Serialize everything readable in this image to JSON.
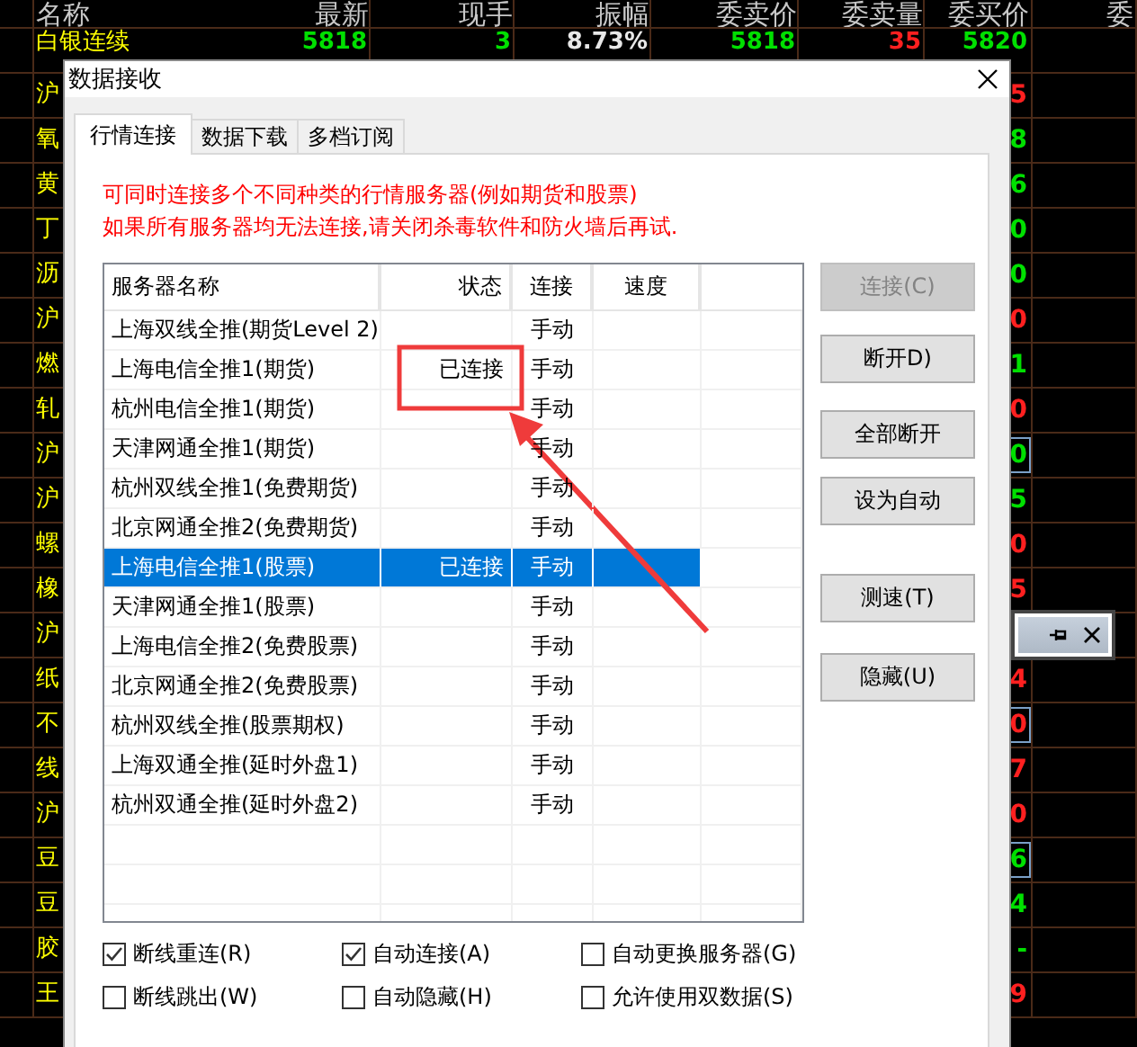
{
  "market_table": {
    "columns": [
      "名称",
      "最新",
      "现手",
      "振幅",
      "委卖价",
      "委卖量",
      "委买价",
      "委"
    ],
    "rows": [
      {
        "cells": [
          {
            "text": "白银连续"
          },
          {
            "text": "5818",
            "kind": "down"
          },
          {
            "text": "3",
            "kind": "down"
          },
          {
            "text": "8.73%",
            "kind": "flat"
          },
          {
            "text": "5818",
            "kind": "down"
          },
          {
            "text": "35",
            "kind": "up"
          },
          {
            "text": "5820",
            "kind": "down",
            "boxed": false
          }
        ]
      },
      {
        "cells": [
          {
            "text": "沪"
          },
          null,
          null,
          null,
          null,
          null,
          {
            "text": "5",
            "kind": "up",
            "boxed": false
          }
        ]
      },
      {
        "cells": [
          {
            "text": "氧"
          },
          null,
          null,
          null,
          null,
          null,
          {
            "text": "8",
            "kind": "down",
            "boxed": false
          }
        ]
      },
      {
        "cells": [
          {
            "text": "黄"
          },
          null,
          null,
          null,
          null,
          null,
          {
            "text": "6",
            "kind": "down",
            "boxed": false
          }
        ]
      },
      {
        "cells": [
          {
            "text": "丁"
          },
          null,
          null,
          null,
          null,
          null,
          {
            "text": "0",
            "kind": "down",
            "boxed": false
          }
        ]
      },
      {
        "cells": [
          {
            "text": "沥"
          },
          null,
          null,
          null,
          null,
          null,
          {
            "text": "0",
            "kind": "down",
            "boxed": false
          }
        ]
      },
      {
        "cells": [
          {
            "text": "沪"
          },
          null,
          null,
          null,
          null,
          null,
          {
            "text": "0",
            "kind": "up",
            "boxed": false
          }
        ]
      },
      {
        "cells": [
          {
            "text": "燃"
          },
          null,
          null,
          null,
          null,
          null,
          {
            "text": "1",
            "kind": "down",
            "boxed": false
          }
        ]
      },
      {
        "cells": [
          {
            "text": "轧"
          },
          null,
          null,
          null,
          null,
          null,
          {
            "text": "0",
            "kind": "up",
            "boxed": false
          }
        ]
      },
      {
        "cells": [
          {
            "text": "沪"
          },
          null,
          null,
          null,
          null,
          null,
          {
            "text": "0",
            "kind": "down",
            "boxed": true
          }
        ]
      },
      {
        "cells": [
          {
            "text": "沪"
          },
          null,
          null,
          null,
          null,
          null,
          {
            "text": "5",
            "kind": "down",
            "boxed": false
          }
        ]
      },
      {
        "cells": [
          {
            "text": "螺"
          },
          null,
          null,
          null,
          null,
          null,
          {
            "text": "0",
            "kind": "up",
            "boxed": false
          }
        ]
      },
      {
        "cells": [
          {
            "text": "橡"
          },
          null,
          null,
          null,
          null,
          null,
          {
            "text": "5",
            "kind": "up",
            "boxed": false
          }
        ]
      },
      {
        "cells": [
          {
            "text": "沪"
          },
          null,
          null,
          null,
          null,
          null,
          null
        ]
      },
      {
        "cells": [
          {
            "text": "纸"
          },
          null,
          null,
          null,
          null,
          null,
          {
            "text": "4",
            "kind": "up",
            "boxed": false
          }
        ]
      },
      {
        "cells": [
          {
            "text": "不"
          },
          null,
          null,
          null,
          null,
          null,
          {
            "text": "0",
            "kind": "up",
            "boxed": true
          }
        ]
      },
      {
        "cells": [
          {
            "text": "线"
          },
          null,
          null,
          null,
          null,
          null,
          {
            "text": "7",
            "kind": "up",
            "boxed": false
          }
        ]
      },
      {
        "cells": [
          {
            "text": "沪"
          },
          null,
          null,
          null,
          null,
          null,
          {
            "text": "0",
            "kind": "up",
            "boxed": false
          }
        ]
      },
      {
        "cells": [
          {
            "text": "豆"
          },
          null,
          null,
          null,
          null,
          null,
          {
            "text": "6",
            "kind": "down",
            "boxed": true
          }
        ]
      },
      {
        "cells": [
          {
            "text": "豆"
          },
          null,
          null,
          null,
          null,
          null,
          {
            "text": "4",
            "kind": "down",
            "boxed": false
          }
        ]
      },
      {
        "cells": [
          {
            "text": "胶"
          },
          null,
          null,
          null,
          null,
          null,
          {
            "text": "-",
            "kind": "down",
            "boxed": false
          }
        ]
      },
      {
        "cells": [
          {
            "text": "王"
          },
          null,
          null,
          null,
          null,
          null,
          {
            "text": "9",
            "kind": "up",
            "boxed": false
          }
        ]
      }
    ]
  },
  "dialog": {
    "title": "数据接收",
    "tabs": [
      {
        "label": "行情连接",
        "selected": true
      },
      {
        "label": "数据下载",
        "selected": false
      },
      {
        "label": "多档订阅",
        "selected": false
      }
    ],
    "notes": [
      "可同时连接多个不同种类的行情服务器(例如期货和股票)",
      "如果所有服务器均无法连接,请关闭杀毒软件和防火墙后再试."
    ],
    "server_table": {
      "columns": [
        "服务器名称",
        "状态",
        "连接",
        "速度"
      ],
      "rows": [
        {
          "name": "上海双线全推(期货Level 2)",
          "connect": "手动",
          "selected": false
        },
        {
          "name": "上海电信全推1(期货)",
          "status": "已连接",
          "connect": "手动",
          "selected": false
        },
        {
          "name": "杭州电信全推1(期货)",
          "connect": "手动",
          "selected": false
        },
        {
          "name": "天津网通全推1(期货)",
          "connect": "手动",
          "selected": false
        },
        {
          "name": "杭州双线全推1(免费期货)",
          "connect": "手动",
          "selected": false
        },
        {
          "name": "北京网通全推2(免费期货)",
          "connect": "手动",
          "selected": false
        },
        {
          "name": "上海电信全推1(股票)",
          "status": "已连接",
          "connect": "手动",
          "selected": true
        },
        {
          "name": "天津网通全推1(股票)",
          "connect": "手动",
          "selected": false
        },
        {
          "name": "上海电信全推2(免费股票)",
          "connect": "手动",
          "selected": false
        },
        {
          "name": "北京网通全推2(免费股票)",
          "connect": "手动",
          "selected": false
        },
        {
          "name": "杭州双线全推(股票期权)",
          "connect": "手动",
          "selected": false
        },
        {
          "name": "上海双通全推(延时外盘1)",
          "connect": "手动",
          "selected": false
        },
        {
          "name": "杭州双通全推(延时外盘2)",
          "connect": "手动",
          "selected": false
        }
      ]
    },
    "buttons": [
      {
        "label": "连接(C)",
        "disabled": true
      },
      {
        "label": "断开D)",
        "disabled": false
      },
      {
        "label": "全部断开",
        "disabled": false
      },
      {
        "label": "设为自动",
        "disabled": false
      },
      {
        "label": "测速(T)",
        "disabled": false
      },
      {
        "label": "隐藏(U)",
        "disabled": false
      }
    ],
    "options": [
      {
        "label": "断线重连(R)",
        "checked": true
      },
      {
        "label": "自动连接(A)",
        "checked": true
      },
      {
        "label": "自动更换服务器(G)",
        "checked": false
      },
      {
        "label": "断线跳出(W)",
        "checked": false
      },
      {
        "label": "自动隐藏(H)",
        "checked": false
      },
      {
        "label": "允许使用双数据(S)",
        "checked": false
      }
    ]
  }
}
